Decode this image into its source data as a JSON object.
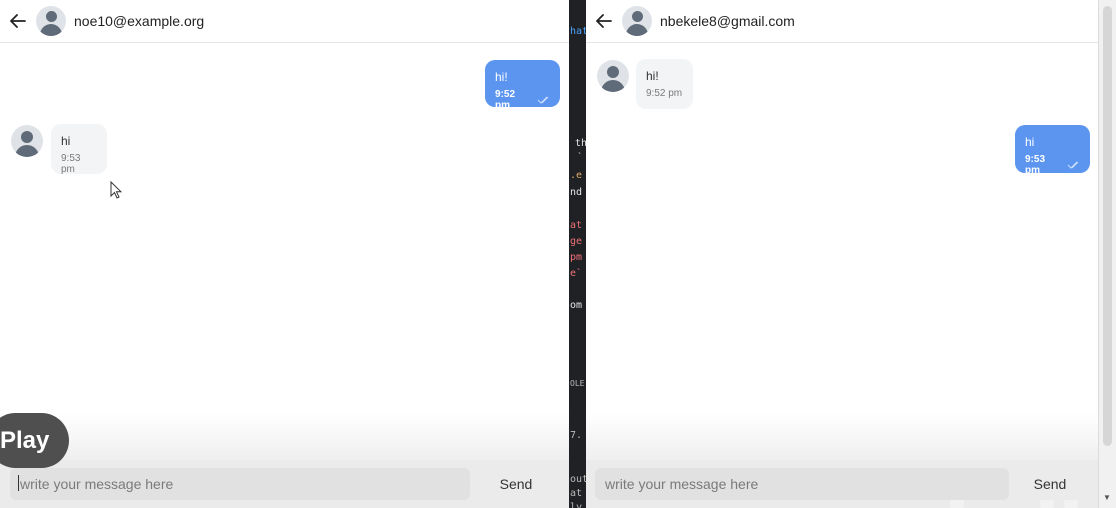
{
  "left_chat": {
    "contact_email": "noe10@example.org",
    "messages": [
      {
        "direction": "out",
        "text": "hi!",
        "time": "9:52 pm",
        "read": true
      },
      {
        "direction": "in",
        "text": "hi",
        "time": "9:53 pm"
      }
    ],
    "input": {
      "placeholder": "write your message here",
      "value": ""
    },
    "send_label": "Send"
  },
  "right_chat": {
    "contact_email": "nbekele8@gmail.com",
    "messages": [
      {
        "direction": "in",
        "text": "hi!",
        "time": "9:52 pm"
      },
      {
        "direction": "out",
        "text": "hi",
        "time": "9:53 pm",
        "read": true
      }
    ],
    "input": {
      "placeholder": "write your message here",
      "value": ""
    },
    "send_label": "Send"
  },
  "overlay": {
    "play_label": "Play"
  },
  "terminal_fragments": [
    "hat",
    "th",
    "`",
    ".e",
    "nd",
    "at",
    "ge",
    "pm",
    "e`",
    "om",
    "OLE",
    "7.",
    "out",
    "at",
    "ly"
  ],
  "colors": {
    "outgoing_bubble": "#5b95ef",
    "incoming_bubble": "#f3f4f6",
    "input_bar": "#ebebeb"
  },
  "icons": [
    "back-arrow-icon",
    "avatar-icon",
    "double-check-icon",
    "mouse-pointer-icon"
  ]
}
